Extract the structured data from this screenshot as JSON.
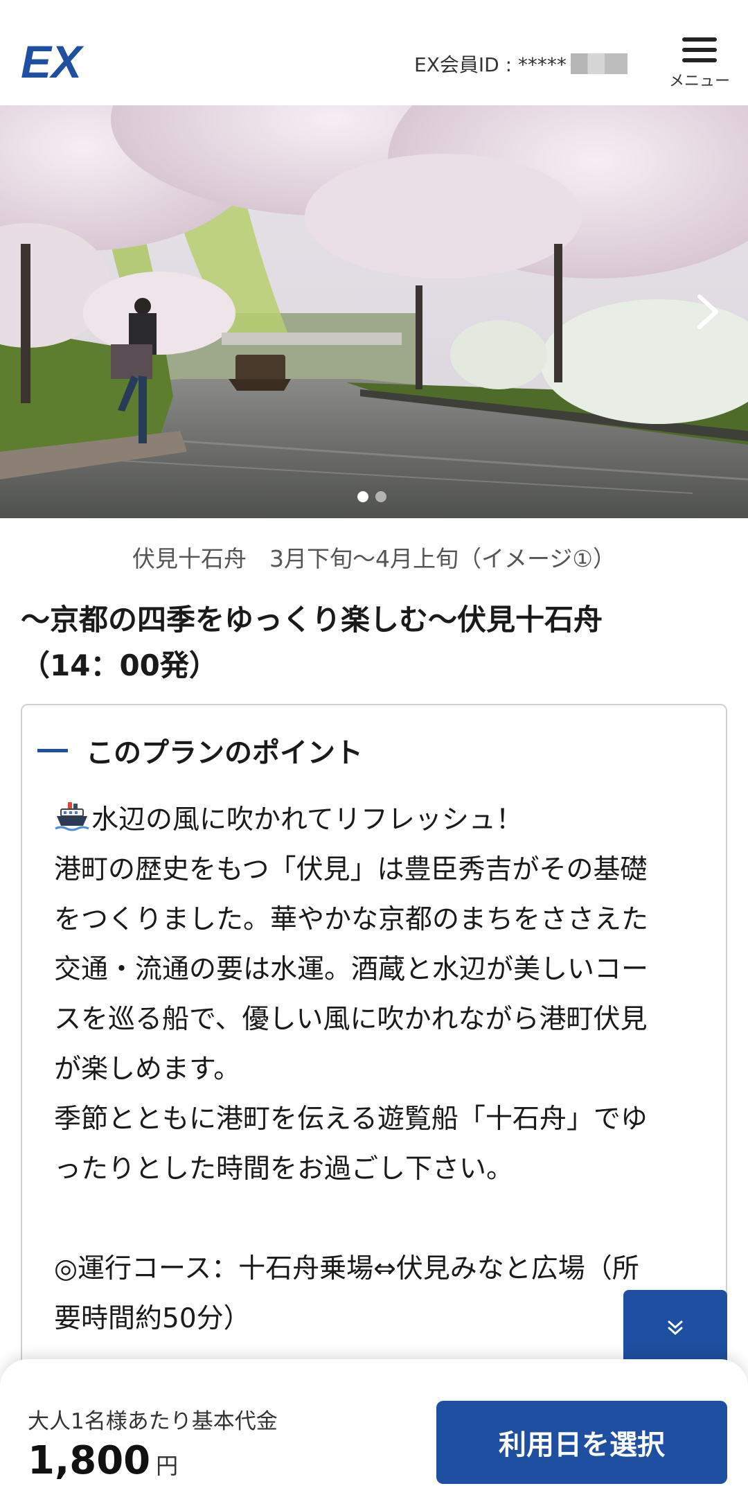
{
  "header": {
    "logo_text": "EX",
    "member_id": "EX会員ID : *****",
    "menu_label": "メニュー"
  },
  "hero": {
    "slide_count": 2,
    "active_slide": 1,
    "caption": "伏見十石舟　3月下旬～4月上旬（イメージ①）"
  },
  "plan": {
    "title_line1": "～京都の四季をゆっくり楽しむ～伏見十石舟",
    "title_line2": "（14：00発）"
  },
  "point": {
    "heading": "このプランのポイント",
    "lines": [
      "水辺の風に吹かれてリフレッシュ！",
      "港町の歴史をもつ「伏見」は豊臣秀吉がその基礎",
      "をつくりました。華やかな京都のまちをささえた",
      "交通・流通の要は水運。酒蔵と水辺が美しいコー",
      "スを巡る船で、優しい風に吹かれながら港町伏見",
      "が楽しめます。",
      "季節とともに港町を伝える遊覧船「十石舟」でゆ",
      "ったりとした時間をお過ごし下さい。",
      "",
      "◎運行コース：十石舟乗場⇔伏見みなと広場（所",
      "要時間約50分）"
    ]
  },
  "footer": {
    "price_label": "大人1名様あたり基本代金",
    "price_value": "1,800",
    "price_unit": "円",
    "select_button": "利用日を選択"
  },
  "colors": {
    "brand_blue": "#1e4fa0"
  },
  "icons": {
    "ship": "ship-icon",
    "menu": "hamburger-icon",
    "next": "chevron-right-icon",
    "scroll": "double-chevron-down-icon"
  }
}
